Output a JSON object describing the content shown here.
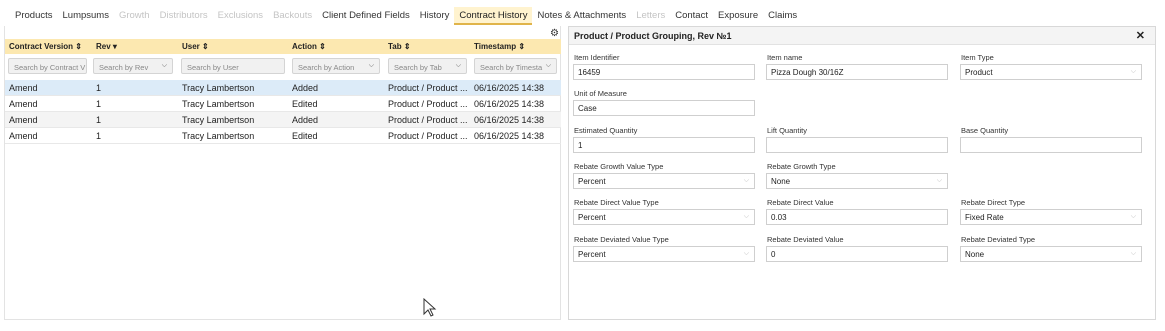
{
  "tabs": [
    {
      "label": "Products",
      "state": "normal"
    },
    {
      "label": "Lumpsums",
      "state": "normal"
    },
    {
      "label": "Growth",
      "state": "disabled"
    },
    {
      "label": "Distributors",
      "state": "disabled"
    },
    {
      "label": "Exclusions",
      "state": "disabled"
    },
    {
      "label": "Backouts",
      "state": "disabled"
    },
    {
      "label": "Client Defined Fields",
      "state": "normal"
    },
    {
      "label": "History",
      "state": "normal"
    },
    {
      "label": "Contract History",
      "state": "active"
    },
    {
      "label": "Notes & Attachments",
      "state": "normal"
    },
    {
      "label": "Letters",
      "state": "disabled"
    },
    {
      "label": "Contact",
      "state": "normal"
    },
    {
      "label": "Exposure",
      "state": "normal"
    },
    {
      "label": "Claims",
      "state": "normal"
    }
  ],
  "grid": {
    "settings_icon": "gear-icon",
    "columns": [
      {
        "label": "Contract Version",
        "sort": "⇕"
      },
      {
        "label": "Rev",
        "sort": "▾"
      },
      {
        "label": "User",
        "sort": "⇕"
      },
      {
        "label": "Action",
        "sort": "⇕"
      },
      {
        "label": "Tab",
        "sort": "⇕"
      },
      {
        "label": "Timestamp",
        "sort": "⇕"
      }
    ],
    "filters": [
      {
        "placeholder": "Search by Contract V",
        "dropdown": false
      },
      {
        "placeholder": "Search by Rev",
        "dropdown": true
      },
      {
        "placeholder": "Search by User",
        "dropdown": false
      },
      {
        "placeholder": "Search by Action",
        "dropdown": true
      },
      {
        "placeholder": "Search by Tab",
        "dropdown": true
      },
      {
        "placeholder": "Search by Timesta",
        "dropdown": true
      }
    ],
    "rows": [
      {
        "version": "Amend",
        "rev": "1",
        "user": "Tracy Lambertson",
        "action": "Added",
        "tab": "Product / Product ...",
        "timestamp": "06/16/2025 14:38",
        "selected": true
      },
      {
        "version": "Amend",
        "rev": "1",
        "user": "Tracy Lambertson",
        "action": "Edited",
        "tab": "Product / Product ...",
        "timestamp": "06/16/2025 14:38",
        "selected": false
      },
      {
        "version": "Amend",
        "rev": "1",
        "user": "Tracy Lambertson",
        "action": "Added",
        "tab": "Product / Product ...",
        "timestamp": "06/16/2025 14:38",
        "selected": false
      },
      {
        "version": "Amend",
        "rev": "1",
        "user": "Tracy Lambertson",
        "action": "Edited",
        "tab": "Product / Product ...",
        "timestamp": "06/16/2025 14:38",
        "selected": false
      }
    ]
  },
  "detail": {
    "title": "Product / Product Grouping, Rev №1",
    "close_label": "✕",
    "fields": {
      "item_identifier": {
        "label": "Item Identifier",
        "value": "16459"
      },
      "item_name": {
        "label": "Item name",
        "value": "Pizza Dough  30/16Z"
      },
      "item_type": {
        "label": "Item Type",
        "value": "Product"
      },
      "unit_of_measure": {
        "label": "Unit of Measure",
        "value": "Case"
      },
      "estimated_quantity": {
        "label": "Estimated Quantity",
        "value": "1"
      },
      "lift_quantity": {
        "label": "Lift Quantity",
        "value": ""
      },
      "base_quantity": {
        "label": "Base Quantity",
        "value": ""
      },
      "rebate_growth_value_type": {
        "label": "Rebate Growth Value Type",
        "value": "Percent"
      },
      "rebate_growth_type": {
        "label": "Rebate Growth Type",
        "value": "None"
      },
      "rebate_direct_value_type": {
        "label": "Rebate Direct Value Type",
        "value": "Percent"
      },
      "rebate_direct_value": {
        "label": "Rebate Direct Value",
        "value": "0.03"
      },
      "rebate_direct_type": {
        "label": "Rebate Direct Type",
        "value": "Fixed Rate"
      },
      "rebate_deviated_value_type": {
        "label": "Rebate Deviated Value Type",
        "value": "Percent"
      },
      "rebate_deviated_value": {
        "label": "Rebate Deviated Value",
        "value": "0"
      },
      "rebate_deviated_type": {
        "label": "Rebate Deviated Type",
        "value": "None"
      }
    }
  },
  "icons": {
    "sort_both": "⇕",
    "sort_desc": "▾",
    "dropdown": "⌵",
    "gear": "⚙",
    "pointer": "mouse-pointer-icon"
  }
}
